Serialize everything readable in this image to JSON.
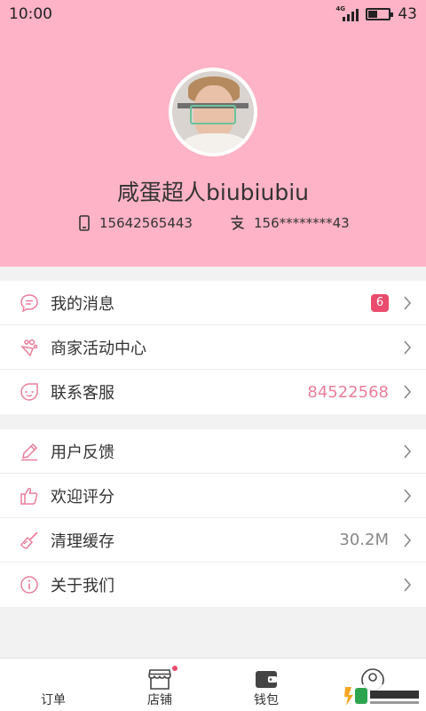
{
  "status_bar": {
    "time": "10:00",
    "network": "4G",
    "battery": "43",
    "battery_level": 0.43
  },
  "profile": {
    "name": "咸蛋超人biubiubiu",
    "phone": "15642565443",
    "alipay": "156********43"
  },
  "menu_group_1": [
    {
      "label": "我的消息",
      "badge": "6",
      "icon": "message-icon"
    },
    {
      "label": "商家活动中心",
      "icon": "gift-icon"
    },
    {
      "label": "联系客服",
      "value": "84522568",
      "icon": "service-icon"
    }
  ],
  "menu_group_2": [
    {
      "label": "用户反馈",
      "icon": "pencil-icon"
    },
    {
      "label": "欢迎评分",
      "icon": "thumbs-up-icon"
    },
    {
      "label": "清理缓存",
      "value": "30.2M",
      "icon": "broom-icon"
    },
    {
      "label": "关于我们",
      "icon": "info-icon"
    }
  ],
  "bottom_nav": {
    "orders": "订单",
    "store": "店铺",
    "wallet": "钱包",
    "me": ""
  },
  "colors": {
    "accent": "#ffb3c7",
    "badge": "#e94c6c",
    "pink_text": "#e97f9a"
  }
}
